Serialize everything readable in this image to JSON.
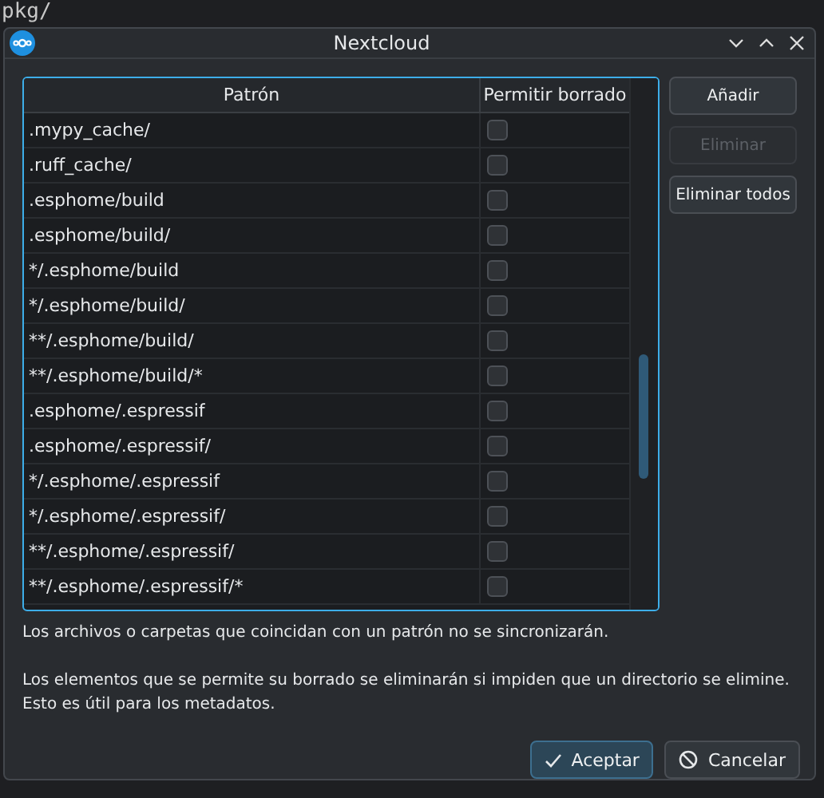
{
  "background_lines_top": [
    "pkg/"
  ],
  "window": {
    "title": "Nextcloud"
  },
  "table": {
    "columns": [
      "Patrón",
      "Permitir borrado"
    ],
    "rows": [
      {
        "pattern": ".mypy_cache/",
        "checked": false
      },
      {
        "pattern": ".ruff_cache/",
        "checked": false
      },
      {
        "pattern": ".esphome/build",
        "checked": false
      },
      {
        "pattern": ".esphome/build/",
        "checked": false
      },
      {
        "pattern": "*/.esphome/build",
        "checked": false
      },
      {
        "pattern": "*/.esphome/build/",
        "checked": false
      },
      {
        "pattern": "**/.esphome/build/",
        "checked": false
      },
      {
        "pattern": "**/.esphome/build/*",
        "checked": false
      },
      {
        "pattern": ".esphome/.espressif",
        "checked": false
      },
      {
        "pattern": ".esphome/.espressif/",
        "checked": false
      },
      {
        "pattern": "*/.esphome/.espressif",
        "checked": false
      },
      {
        "pattern": "*/.esphome/.espressif/",
        "checked": false
      },
      {
        "pattern": "**/.esphome/.espressif/",
        "checked": false
      },
      {
        "pattern": "**/.esphome/.espressif/*",
        "checked": false
      }
    ]
  },
  "side_buttons": [
    {
      "label": "Añadir",
      "disabled": false
    },
    {
      "label": "Eliminar",
      "disabled": true
    },
    {
      "label": "Eliminar todos",
      "disabled": false
    }
  ],
  "info": [
    "Los archivos o carpetas que coincidan con un patrón no se sincronizarán.",
    "Los elementos que se permite su borrado se eliminarán si impiden que un directorio se elimine. Esto es útil para los metadatos."
  ],
  "buttons": [
    {
      "kind": "accept",
      "label": "Aceptar"
    },
    {
      "kind": "cancel",
      "label": "Cancelar"
    }
  ]
}
